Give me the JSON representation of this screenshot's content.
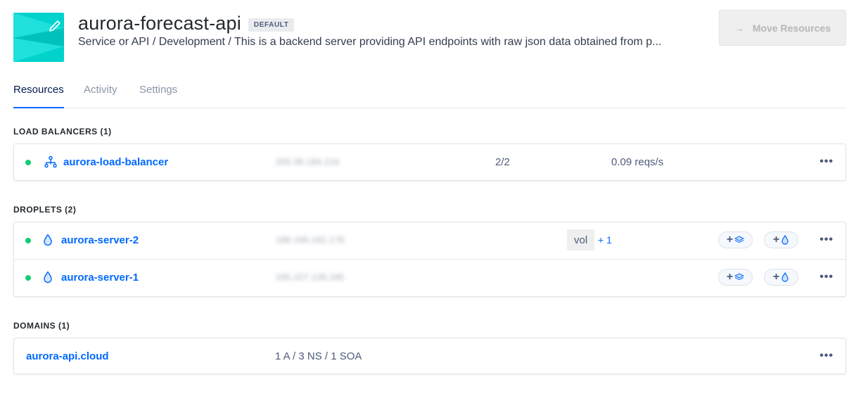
{
  "project": {
    "title": "aurora-forecast-api",
    "badge": "DEFAULT",
    "subtitle": "Service or API / Development / This is a backend server providing API endpoints with raw json data obtained from p...",
    "move_button_label": "Move Resources"
  },
  "colors": {
    "accent": "#0069ff",
    "status_active": "#15cd72",
    "project_icon": "#00d2cc"
  },
  "tabs": [
    {
      "label": "Resources",
      "active": true
    },
    {
      "label": "Activity",
      "active": false
    },
    {
      "label": "Settings",
      "active": false
    }
  ],
  "sections": {
    "load_balancers": {
      "title": "LOAD BALANCERS (1)",
      "items": [
        {
          "name": "aurora-load-balancer",
          "ip": "205.38.184.216",
          "droplets": "2/2",
          "requests": "0.09 reqs/s",
          "icon": "load-balancer-icon"
        }
      ]
    },
    "droplets": {
      "title": "DROPLETS (2)",
      "items": [
        {
          "name": "aurora-server-2",
          "ip": "188.166.162.176",
          "volume": "vol",
          "volume_extra": "+ 1",
          "icon": "droplet-icon"
        },
        {
          "name": "aurora-server-1",
          "ip": "165.227.128.165",
          "icon": "droplet-icon"
        }
      ]
    },
    "domains": {
      "title": "DOMAINS (1)",
      "items": [
        {
          "name": "aurora-api.cloud",
          "records": "1 A / 3 NS / 1 SOA"
        }
      ]
    }
  },
  "row_menu_glyph": "•••",
  "add_glyph": "+",
  "move_arrow_glyph": "→"
}
